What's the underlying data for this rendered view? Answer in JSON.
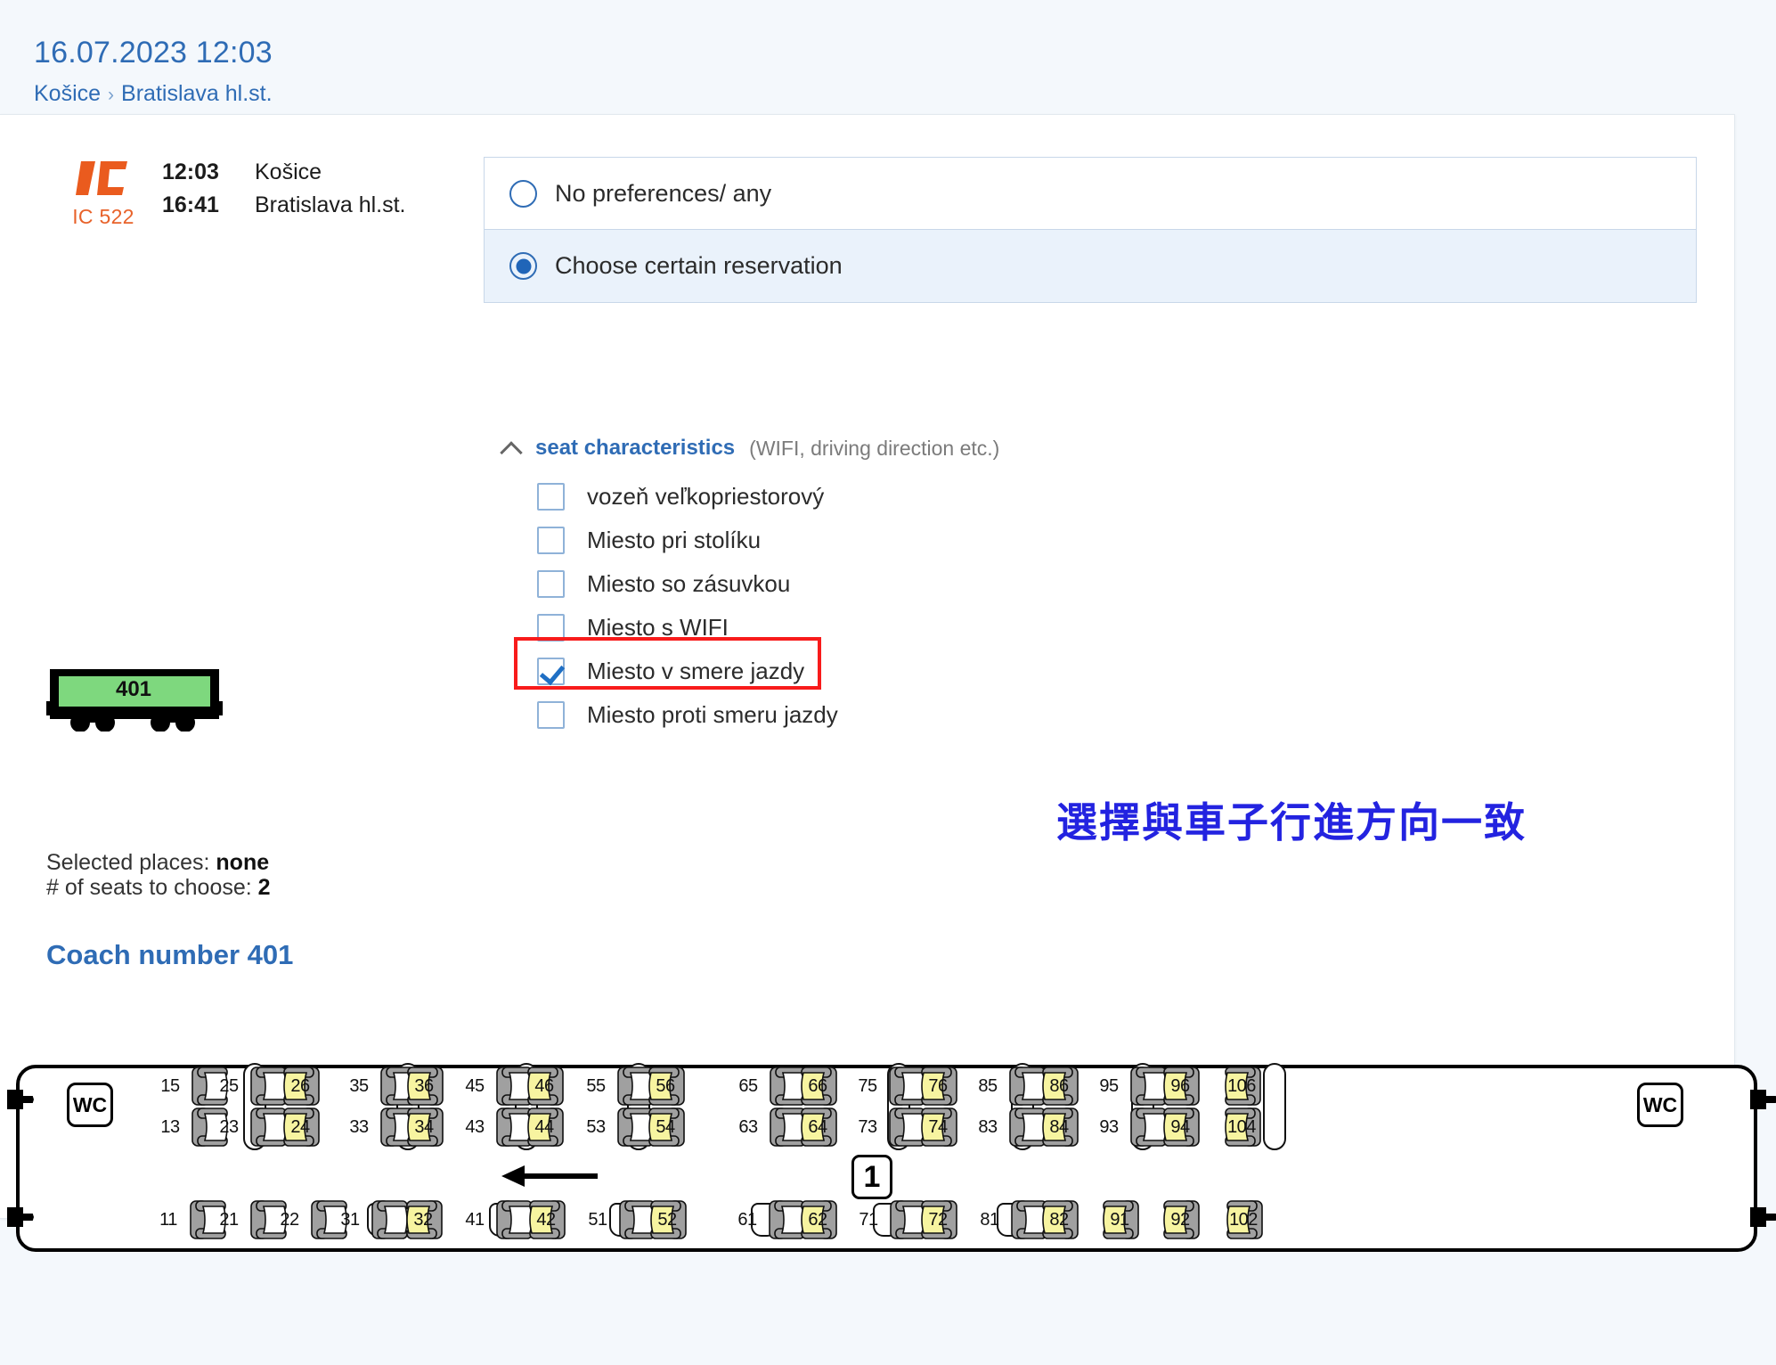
{
  "header": {
    "datetime": "16.07.2023 12:03",
    "origin": "Košice",
    "separator": "›",
    "destination": "Bratislava hl.st."
  },
  "train": {
    "logo_icon": "ic-logo-icon",
    "code": "IC 522",
    "departure_time": "12:03",
    "departure_station": "Košice",
    "arrival_time": "16:41",
    "arrival_station": "Bratislava hl.st."
  },
  "reservation_options": [
    {
      "label": "No preferences/ any",
      "selected": false
    },
    {
      "label": "Choose certain reservation",
      "selected": true
    }
  ],
  "characteristics": {
    "toggle_icon": "chevron-up-icon",
    "title": "seat characteristics",
    "subtitle": "(WIFI, driving direction etc.)",
    "items": [
      {
        "label": "vozeň veľkopriestorový",
        "checked": false
      },
      {
        "label": "Miesto pri stolíku",
        "checked": false
      },
      {
        "label": "Miesto so zásuvkou",
        "checked": false
      },
      {
        "label": "Miesto s WIFI",
        "checked": false
      },
      {
        "label": "Miesto v smere jazdy",
        "checked": true,
        "highlighted": true
      },
      {
        "label": "Miesto proti smeru jazdy",
        "checked": false
      }
    ]
  },
  "annotation": {
    "text": "選擇與車子行進方向一致",
    "color": "#2323e0"
  },
  "wagon": {
    "number": "401",
    "color": "#7ed87e",
    "selected_places_label": "Selected places:",
    "selected_places_value": "none",
    "seats_to_choose_label": "# of seats to choose:",
    "seats_to_choose_value": "2"
  },
  "coach_title": "Coach number 401",
  "seatmap": {
    "class_badge": "1",
    "direction_arrow_icon": "arrow-left-icon",
    "wc_left_label": "WC",
    "wc_right_label": "WC",
    "legend": {
      "available_color": "#ffffff",
      "matching_color": "#f7f4a0",
      "frame_color": "#a0a0a0"
    },
    "top_rows": {
      "upper": [
        "15",
        "25",
        "26",
        "35",
        "36",
        "45",
        "46",
        "55",
        "56",
        "65",
        "66",
        "75",
        "76",
        "85",
        "86",
        "95",
        "96",
        "106"
      ],
      "lower": [
        "13",
        "23",
        "24",
        "33",
        "34",
        "43",
        "44",
        "53",
        "54",
        "63",
        "64",
        "73",
        "74",
        "83",
        "84",
        "93",
        "94",
        "104"
      ]
    },
    "bottom_row": [
      "11",
      "21",
      "22",
      "31",
      "32",
      "41",
      "42",
      "51",
      "52",
      "61",
      "62",
      "71",
      "72",
      "81",
      "82",
      "91",
      "92",
      "102"
    ],
    "highlighted_seats": [
      "26",
      "24",
      "36",
      "34",
      "46",
      "44",
      "56",
      "54",
      "66",
      "64",
      "76",
      "74",
      "86",
      "84",
      "96",
      "94",
      "106",
      "104",
      "32",
      "42",
      "52",
      "62",
      "72",
      "82",
      "91",
      "92",
      "102"
    ]
  }
}
